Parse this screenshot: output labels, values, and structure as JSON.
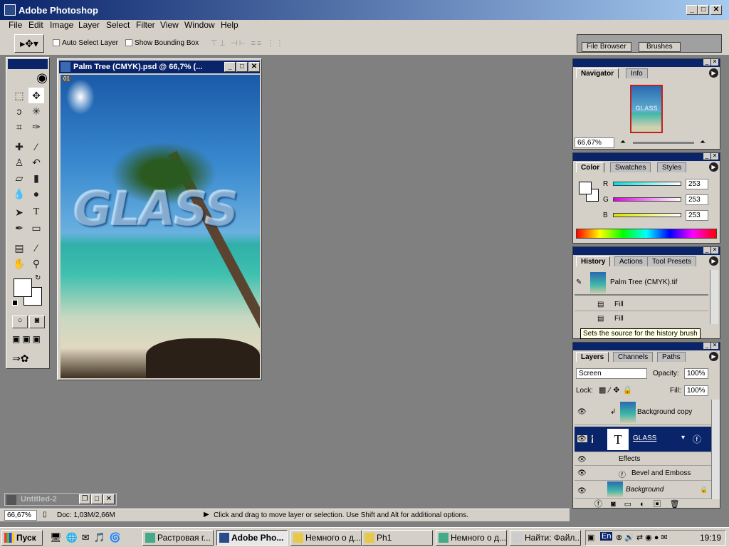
{
  "app": {
    "title": "Adobe Photoshop",
    "window_controls": [
      "_",
      "□",
      "✕"
    ]
  },
  "menu": [
    "File",
    "Edit",
    "Image",
    "Layer",
    "Select",
    "Filter",
    "View",
    "Window",
    "Help"
  ],
  "options": {
    "auto_select": "Auto Select Layer",
    "bounding_box": "Show Bounding Box",
    "file_browser": "File Browser",
    "brushes": "Brushes"
  },
  "document": {
    "title": "Palm Tree (CMYK).psd @ 66,7% (...",
    "badge": "01",
    "overlay_text": "GLASS"
  },
  "minimized_doc": {
    "title": "Untitled-2"
  },
  "navigator": {
    "tabs": [
      "Navigator",
      "Info"
    ],
    "zoom": "66,67%",
    "thumb_text": "GLASS"
  },
  "color": {
    "tabs": [
      "Color",
      "Swatches",
      "Styles"
    ],
    "channels": [
      {
        "label": "R",
        "value": "253",
        "color": "#00e0e0"
      },
      {
        "label": "G",
        "value": "253",
        "color": "#e000e0"
      },
      {
        "label": "B",
        "value": "253",
        "color": "#e0e000"
      }
    ]
  },
  "history": {
    "tabs": [
      "History",
      "Actions",
      "Tool Presets"
    ],
    "snapshot": "Palm Tree (CMYK).tif",
    "items": [
      "Fill",
      "Fill"
    ],
    "tooltip": "Sets the source for the history brush"
  },
  "layers": {
    "tabs": [
      "Layers",
      "Channels",
      "Paths"
    ],
    "blend_mode": "Screen",
    "opacity_label": "Opacity:",
    "opacity": "100%",
    "lock_label": "Lock:",
    "fill_label": "Fill:",
    "fill": "100%",
    "rows": [
      {
        "name": "Background copy"
      },
      {
        "name": "GLASS"
      },
      {
        "name": "Effects"
      },
      {
        "name": "Bevel and Emboss"
      },
      {
        "name": "Background"
      }
    ]
  },
  "status": {
    "zoom": "66,67%",
    "doc": "Doc: 1,03M/2,66M",
    "hint": "Click and drag to move layer or selection.  Use Shift and Alt for additional options."
  },
  "taskbar": {
    "start": "Пуск",
    "items": [
      "Растровая г...",
      "Adobe Pho...",
      "Немного о д...",
      "Ph1",
      "Немного о д...",
      "Найти: Файл..."
    ],
    "lang": "En",
    "clock": "19:19"
  },
  "colors": {
    "title_start": "#0a246a",
    "title_end": "#a6caf0",
    "panel_bg": "#d4d0c8",
    "workspace": "#808080",
    "selected": "#0a246a"
  }
}
